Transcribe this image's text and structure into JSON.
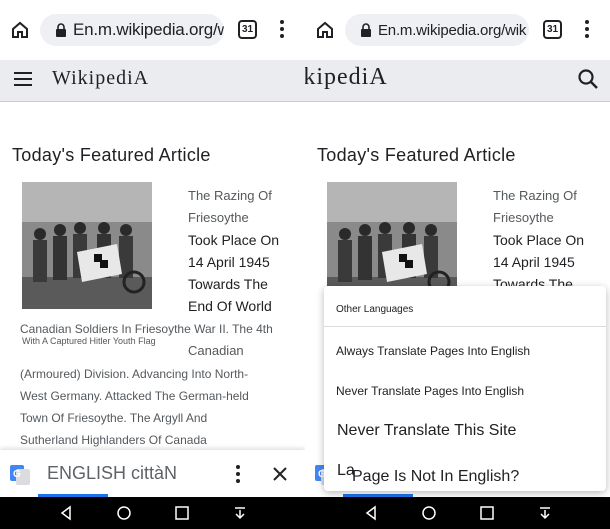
{
  "left": {
    "url": "En.m.wikipedia.org/wik",
    "tab_count": "31",
    "logo": "WikipediA",
    "section_title": "Today's Featured Article",
    "caption": "With A Captured Hitler Youth Flag",
    "text_lines_right": [
      "The Razing Of",
      "Friesoythe",
      "Took Place On",
      "14 April 1945",
      "Towards The",
      "End Of World"
    ],
    "text_line_canadian": "Canadian Soldiers In Friesoythe War II. The 4th",
    "text_line_canadian2": "Canadian",
    "text_lines_full": [
      "(Armoured) Division. Advancing Into North-",
      "West Germany. Attacked The German-held",
      "Town Of Friesoythe. The Argyll And",
      "Sutherland Highlanders Of Canada"
    ],
    "translate_bar": {
      "language": "ENGLISH cittàN"
    }
  },
  "right": {
    "url": "En.m.wikipedia.org/wik",
    "tab_count": "31",
    "logo": "WikipediA",
    "section_title": "Today's Featured Article",
    "text_lines_right": [
      "The Razing Of",
      "Friesoythe",
      "Took Place On",
      "14 April 1945",
      "Towards The"
    ],
    "menu": {
      "header": "Other Languages",
      "items": [
        "Always Translate Pages Into English",
        "Never Translate Pages Into English",
        "Never Translate This Site",
        "Page Is Not In English?"
      ],
      "partial_item": "La"
    }
  },
  "colors": {
    "accent": "#1a73e8",
    "header_bg": "#eaecf0",
    "url_bg": "#eef0f3"
  }
}
